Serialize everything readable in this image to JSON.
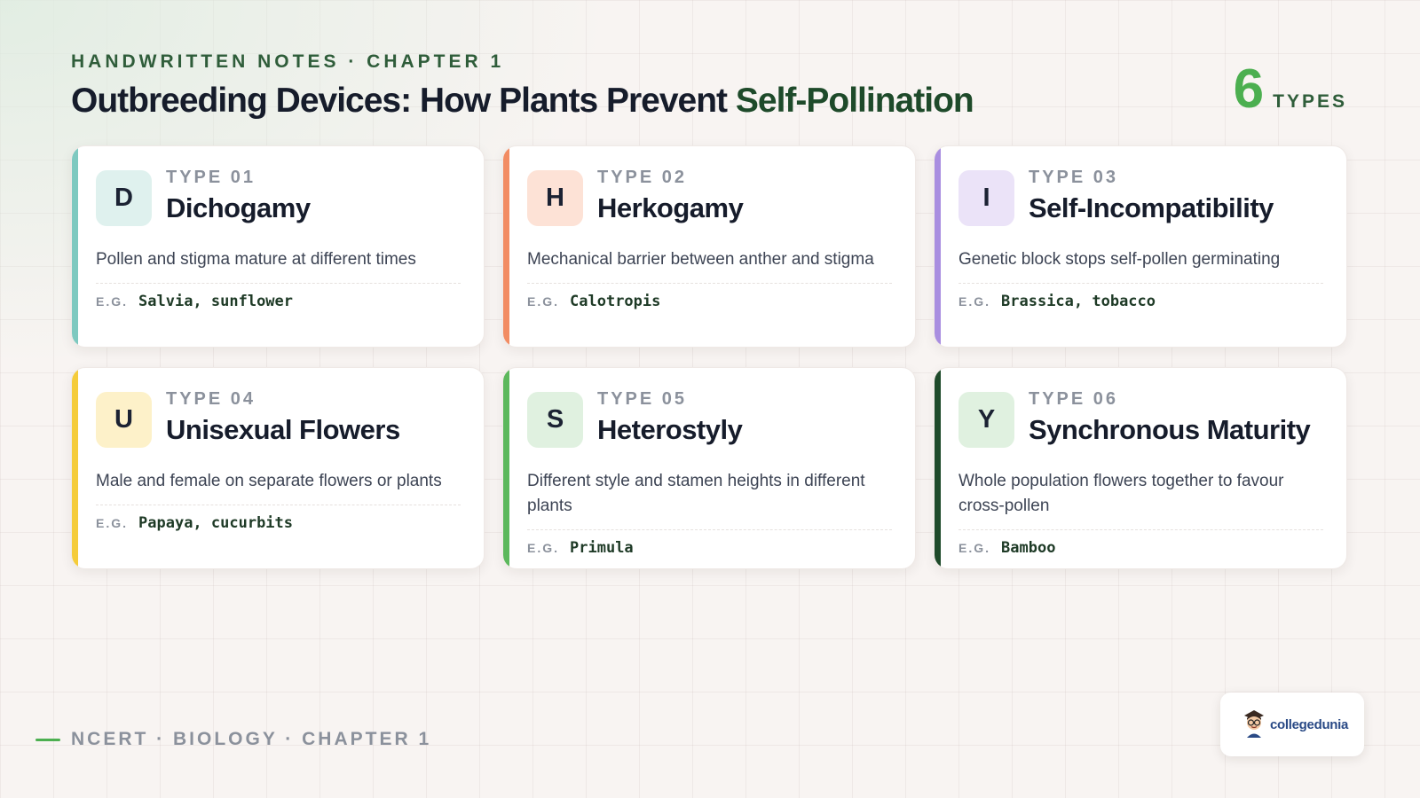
{
  "header": {
    "eyebrow": "HANDWRITTEN NOTES · CHAPTER 1",
    "title_main": "Outbreeding Devices: How Plants Prevent ",
    "title_accent": "Self-Pollination",
    "count_number": "6",
    "count_label": "TYPES"
  },
  "example_label": "E.G.",
  "cards": [
    {
      "letter": "D",
      "type_label": "TYPE 01",
      "title": "Dichogamy",
      "description": "Pollen and stigma mature at different times",
      "example": "Salvia, sunflower",
      "accent_color": "#7ec9c0",
      "badge_color": "#dff1ee"
    },
    {
      "letter": "H",
      "type_label": "TYPE 02",
      "title": "Herkogamy",
      "description": "Mechanical barrier between anther and stigma",
      "example": "Calotropis",
      "accent_color": "#f28c63",
      "badge_color": "#fde2d6"
    },
    {
      "letter": "I",
      "type_label": "TYPE 03",
      "title": "Self-Incompatibility",
      "description": "Genetic block stops self-pollen germinating",
      "example": "Brassica, tobacco",
      "accent_color": "#a98ee0",
      "badge_color": "#ebe3f8"
    },
    {
      "letter": "U",
      "type_label": "TYPE 04",
      "title": "Unisexual Flowers",
      "description": "Male and female on separate flowers or plants",
      "example": "Papaya, cucurbits",
      "accent_color": "#f5cc3a",
      "badge_color": "#fdf1c9"
    },
    {
      "letter": "S",
      "type_label": "TYPE 05",
      "title": "Heterostyly",
      "description": "Different style and stamen heights in different plants",
      "example": "Primula",
      "accent_color": "#5cb85c",
      "badge_color": "#e0f1e0"
    },
    {
      "letter": "Y",
      "type_label": "TYPE 06",
      "title": "Synchronous Maturity",
      "description": "Whole population flowers together to favour cross-pollen",
      "example": "Bamboo",
      "accent_color": "#1e4a2a",
      "badge_color": "#e0f1e0"
    }
  ],
  "footer": {
    "text": "NCERT · BIOLOGY · CHAPTER 1"
  },
  "logo": {
    "text": "collegedunia",
    "icon": "student-mascot-icon"
  },
  "colors": {
    "brand_green": "#4caf50",
    "dark_green": "#1e4a2a",
    "background": "#f8f4f2"
  }
}
